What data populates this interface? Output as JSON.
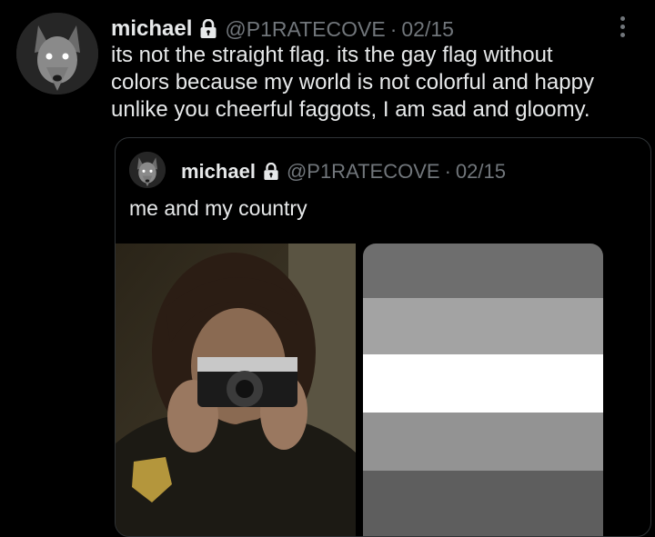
{
  "tweet": {
    "display_name": "michael",
    "handle": "@P1RATECOVE",
    "separator": "·",
    "date": "02/15",
    "text_lines": [
      "its not the straight flag. its the gay flag without",
      "colors because my world is not colorful and happy",
      "unlike you cheerful faggots, I am sad and gloomy."
    ]
  },
  "quoted_tweet": {
    "display_name": "michael",
    "handle": "@P1RATECOVE",
    "separator": "·",
    "date": "02/15",
    "text": "me and my country"
  },
  "icons": {
    "lock": "lock-icon",
    "more": "more-options-icon"
  },
  "flag_stripes": [
    "#6e6e6e",
    "#a3a3a3",
    "#ffffff",
    "#939393",
    "#5e5e5e"
  ],
  "colors": {
    "background": "#000000",
    "text_primary": "#e7e9ea",
    "text_secondary": "#71767b",
    "border": "#2f3336"
  }
}
